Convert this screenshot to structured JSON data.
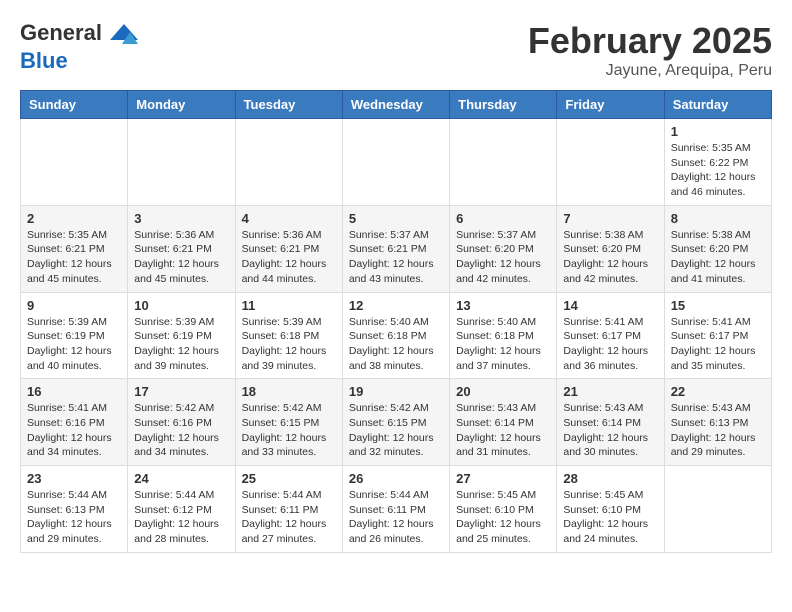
{
  "logo": {
    "line1": "General",
    "line2": "Blue"
  },
  "header": {
    "month": "February 2025",
    "location": "Jayune, Arequipa, Peru"
  },
  "weekdays": [
    "Sunday",
    "Monday",
    "Tuesday",
    "Wednesday",
    "Thursday",
    "Friday",
    "Saturday"
  ],
  "weeks": [
    [
      {
        "day": "",
        "info": ""
      },
      {
        "day": "",
        "info": ""
      },
      {
        "day": "",
        "info": ""
      },
      {
        "day": "",
        "info": ""
      },
      {
        "day": "",
        "info": ""
      },
      {
        "day": "",
        "info": ""
      },
      {
        "day": "1",
        "info": "Sunrise: 5:35 AM\nSunset: 6:22 PM\nDaylight: 12 hours and 46 minutes."
      }
    ],
    [
      {
        "day": "2",
        "info": "Sunrise: 5:35 AM\nSunset: 6:21 PM\nDaylight: 12 hours and 45 minutes."
      },
      {
        "day": "3",
        "info": "Sunrise: 5:36 AM\nSunset: 6:21 PM\nDaylight: 12 hours and 45 minutes."
      },
      {
        "day": "4",
        "info": "Sunrise: 5:36 AM\nSunset: 6:21 PM\nDaylight: 12 hours and 44 minutes."
      },
      {
        "day": "5",
        "info": "Sunrise: 5:37 AM\nSunset: 6:21 PM\nDaylight: 12 hours and 43 minutes."
      },
      {
        "day": "6",
        "info": "Sunrise: 5:37 AM\nSunset: 6:20 PM\nDaylight: 12 hours and 42 minutes."
      },
      {
        "day": "7",
        "info": "Sunrise: 5:38 AM\nSunset: 6:20 PM\nDaylight: 12 hours and 42 minutes."
      },
      {
        "day": "8",
        "info": "Sunrise: 5:38 AM\nSunset: 6:20 PM\nDaylight: 12 hours and 41 minutes."
      }
    ],
    [
      {
        "day": "9",
        "info": "Sunrise: 5:39 AM\nSunset: 6:19 PM\nDaylight: 12 hours and 40 minutes."
      },
      {
        "day": "10",
        "info": "Sunrise: 5:39 AM\nSunset: 6:19 PM\nDaylight: 12 hours and 39 minutes."
      },
      {
        "day": "11",
        "info": "Sunrise: 5:39 AM\nSunset: 6:18 PM\nDaylight: 12 hours and 39 minutes."
      },
      {
        "day": "12",
        "info": "Sunrise: 5:40 AM\nSunset: 6:18 PM\nDaylight: 12 hours and 38 minutes."
      },
      {
        "day": "13",
        "info": "Sunrise: 5:40 AM\nSunset: 6:18 PM\nDaylight: 12 hours and 37 minutes."
      },
      {
        "day": "14",
        "info": "Sunrise: 5:41 AM\nSunset: 6:17 PM\nDaylight: 12 hours and 36 minutes."
      },
      {
        "day": "15",
        "info": "Sunrise: 5:41 AM\nSunset: 6:17 PM\nDaylight: 12 hours and 35 minutes."
      }
    ],
    [
      {
        "day": "16",
        "info": "Sunrise: 5:41 AM\nSunset: 6:16 PM\nDaylight: 12 hours and 34 minutes."
      },
      {
        "day": "17",
        "info": "Sunrise: 5:42 AM\nSunset: 6:16 PM\nDaylight: 12 hours and 34 minutes."
      },
      {
        "day": "18",
        "info": "Sunrise: 5:42 AM\nSunset: 6:15 PM\nDaylight: 12 hours and 33 minutes."
      },
      {
        "day": "19",
        "info": "Sunrise: 5:42 AM\nSunset: 6:15 PM\nDaylight: 12 hours and 32 minutes."
      },
      {
        "day": "20",
        "info": "Sunrise: 5:43 AM\nSunset: 6:14 PM\nDaylight: 12 hours and 31 minutes."
      },
      {
        "day": "21",
        "info": "Sunrise: 5:43 AM\nSunset: 6:14 PM\nDaylight: 12 hours and 30 minutes."
      },
      {
        "day": "22",
        "info": "Sunrise: 5:43 AM\nSunset: 6:13 PM\nDaylight: 12 hours and 29 minutes."
      }
    ],
    [
      {
        "day": "23",
        "info": "Sunrise: 5:44 AM\nSunset: 6:13 PM\nDaylight: 12 hours and 29 minutes."
      },
      {
        "day": "24",
        "info": "Sunrise: 5:44 AM\nSunset: 6:12 PM\nDaylight: 12 hours and 28 minutes."
      },
      {
        "day": "25",
        "info": "Sunrise: 5:44 AM\nSunset: 6:11 PM\nDaylight: 12 hours and 27 minutes."
      },
      {
        "day": "26",
        "info": "Sunrise: 5:44 AM\nSunset: 6:11 PM\nDaylight: 12 hours and 26 minutes."
      },
      {
        "day": "27",
        "info": "Sunrise: 5:45 AM\nSunset: 6:10 PM\nDaylight: 12 hours and 25 minutes."
      },
      {
        "day": "28",
        "info": "Sunrise: 5:45 AM\nSunset: 6:10 PM\nDaylight: 12 hours and 24 minutes."
      },
      {
        "day": "",
        "info": ""
      }
    ]
  ]
}
